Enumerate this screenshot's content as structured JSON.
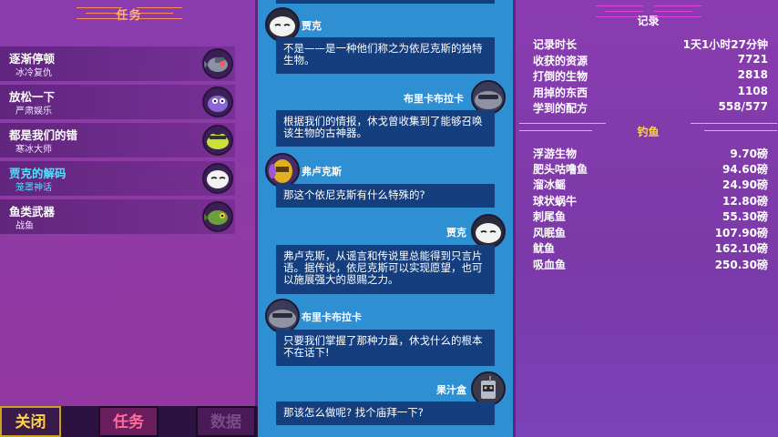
{
  "left": {
    "header": "任务",
    "quests": [
      {
        "title": "逐渐停顿",
        "sub": "冰冷复仇",
        "icon": "robot-fish-icon",
        "active": false
      },
      {
        "title": "放松一下",
        "sub": "严肃娱乐",
        "icon": "purple-blob-icon",
        "active": false
      },
      {
        "title": "都是我们的错",
        "sub": "寒冰大师",
        "icon": "yellow-frog-icon",
        "active": false
      },
      {
        "title": "贾克的解码",
        "sub": "笼罩神话",
        "icon": "white-ghost-icon",
        "active": true
      },
      {
        "title": "鱼类武器",
        "sub": "战鱼",
        "icon": "green-fish-icon",
        "active": false
      }
    ],
    "buttons": {
      "close": "关闭",
      "tasks": "任务",
      "data": "数据"
    }
  },
  "dialog": [
    {
      "speaker": "贾克",
      "side": "left",
      "avatar": "white-ghost-avatar",
      "text": "不是——是一种他们称之为依尼克斯的独特生物。"
    },
    {
      "speaker": "布里卡布拉卡",
      "side": "right",
      "avatar": "gray-blob-avatar",
      "text": "根据我们的情报，休戈曾收集到了能够召唤该生物的古神器。"
    },
    {
      "speaker": "弗卢克斯",
      "side": "left",
      "avatar": "gold-mask-avatar",
      "text": "那这个依尼克斯有什么特殊的?"
    },
    {
      "speaker": "贾克",
      "side": "right",
      "avatar": "white-ghost-avatar",
      "text": "弗卢克斯，从谣言和传说里总能得到只言片语。据传说，依尼克斯可以实现愿望，也可以施展强大的恩赐之力。"
    },
    {
      "speaker": "布里卡布拉卡",
      "side": "left",
      "avatar": "gray-blob-avatar",
      "text": "只要我们掌握了那种力量，休戈什么的根本不在话下!"
    },
    {
      "speaker": "果汁盒",
      "side": "right",
      "avatar": "juicebox-robot-avatar",
      "text": "那该怎么做呢? 找个庙拜一下?"
    }
  ],
  "records": {
    "header": "记录",
    "rows": [
      {
        "k": "记录时长",
        "v": "1天1小时27分钟"
      },
      {
        "k": "收获的资源",
        "v": "7721"
      },
      {
        "k": "打倒的生物",
        "v": "2818"
      },
      {
        "k": "用掉的东西",
        "v": "1108"
      },
      {
        "k": "学到的配方",
        "v": "558/577"
      }
    ]
  },
  "fishing": {
    "header": "钓鱼",
    "rows": [
      {
        "k": "浮游生物",
        "v": "9.70磅"
      },
      {
        "k": "肥头咕噜鱼",
        "v": "94.60磅"
      },
      {
        "k": "溜冰鳐",
        "v": "24.90磅"
      },
      {
        "k": "球状蜗牛",
        "v": "12.80磅"
      },
      {
        "k": "刺尾鱼",
        "v": "55.30磅"
      },
      {
        "k": "风眠鱼",
        "v": "107.90磅"
      },
      {
        "k": "鱿鱼",
        "v": "162.10磅"
      },
      {
        "k": "吸血鱼",
        "v": "250.30磅"
      }
    ]
  },
  "colors": {
    "accent_orange": "#ffb36b",
    "active_cyan": "#4fe3ff",
    "bubble_navy": "#153e7e",
    "dialog_bg": "#2f8fd3",
    "gold_header": "#ffd34a"
  }
}
